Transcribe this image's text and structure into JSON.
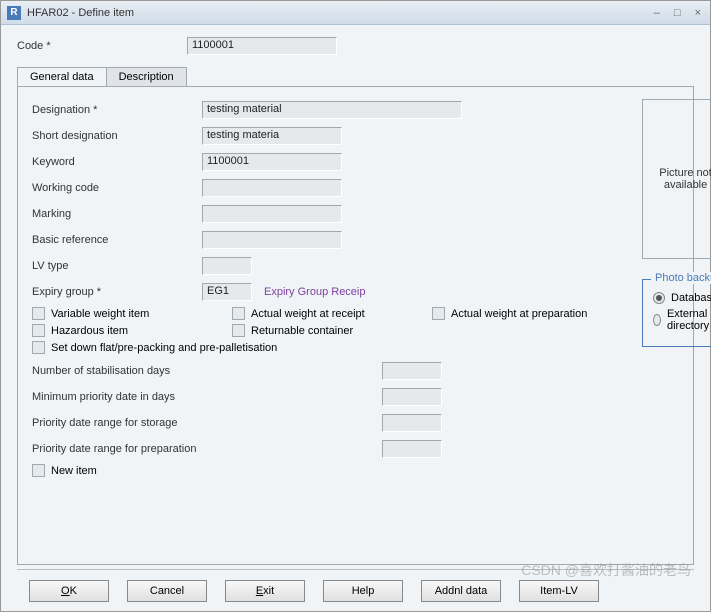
{
  "titlebar": {
    "icon": "R",
    "title": "HFAR02 - Define item"
  },
  "header": {
    "code_label": "Code *",
    "code_value": "1100001"
  },
  "tabs": {
    "general": "General data",
    "description": "Description"
  },
  "form": {
    "designation_label": "Designation *",
    "designation_value": "testing material",
    "short_designation_label": "Short designation",
    "short_designation_value": "testing materia",
    "keyword_label": "Keyword",
    "keyword_value": "1100001",
    "working_code_label": "Working code",
    "working_code_value": "",
    "marking_label": "Marking",
    "marking_value": "",
    "basic_reference_label": "Basic reference",
    "basic_reference_value": "",
    "lv_type_label": "LV type",
    "lv_type_value": "",
    "expiry_group_label": "Expiry group *",
    "expiry_group_value": "EG1",
    "expiry_group_desc": "Expiry Group Receip"
  },
  "checks": {
    "variable_weight": "Variable weight item",
    "actual_weight_receipt": "Actual weight at receipt",
    "actual_weight_prep": "Actual weight at preparation",
    "hazardous": "Hazardous item",
    "returnable": "Returnable container",
    "setdown": "Set down flat/pre-packing and pre-palletisation",
    "new_item": "New item"
  },
  "numfields": {
    "stabilisation_label": "Number of stabilisation days",
    "stabilisation_value": "",
    "min_priority_label": "Minimum priority date in days",
    "min_priority_value": "",
    "priority_storage_label": "Priority date range for storage",
    "priority_storage_value": "",
    "priority_prep_label": "Priority date range for preparation",
    "priority_prep_value": ""
  },
  "picture": {
    "placeholder": "Picture not available"
  },
  "photo_backup": {
    "legend": "Photo backup",
    "database": "Database",
    "external": "External directory",
    "selected": "database"
  },
  "buttons": {
    "ok": "OK",
    "cancel": "Cancel",
    "exit": "Exit",
    "help": "Help",
    "addnl": "Addnl data",
    "itemlv": "Item-LV"
  },
  "watermark": "CSDN @喜欢打酱油的老鸟"
}
